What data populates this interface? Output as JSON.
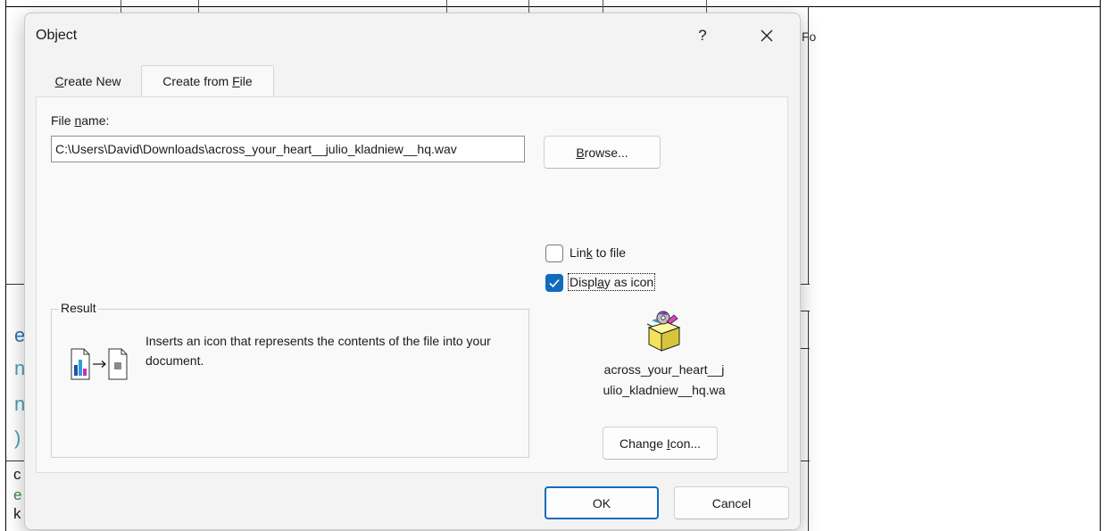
{
  "background": {
    "right_edge_text": "Fo",
    "left_letters": [
      "e",
      "n",
      "n",
      ")",
      "c",
      "e",
      "k"
    ]
  },
  "dialog": {
    "title": "Object",
    "help_label": "?",
    "tabs": [
      {
        "pre": "",
        "key": "C",
        "post": "reate New",
        "selected": false
      },
      {
        "pre": "Create from ",
        "key": "F",
        "post": "ile",
        "selected": true
      }
    ],
    "file_name_label": {
      "pre": "File ",
      "key": "n",
      "post": "ame:"
    },
    "file_name_value": "C:\\Users\\David\\Downloads\\across_your_heart__julio_kladniew__hq.wav",
    "browse_label": {
      "pre": "",
      "key": "B",
      "post": "rowse..."
    },
    "link_to_file": {
      "pre": "Lin",
      "key": "k",
      "post": " to file",
      "checked": false
    },
    "display_as_icon": {
      "pre": "Displ",
      "key": "a",
      "post": "y as icon",
      "checked": true
    },
    "result": {
      "legend": "Result",
      "text": "Inserts an icon that represents the contents of the file into your document."
    },
    "icon_caption_line1": "across_your_heart__j",
    "icon_caption_line2": "ulio_kladniew__hq.wa",
    "change_icon_label": {
      "pre": "Change ",
      "key": "I",
      "post": "con..."
    },
    "ok_label": "OK",
    "cancel_label": "Cancel",
    "accent_color": "#0f6cbd"
  }
}
